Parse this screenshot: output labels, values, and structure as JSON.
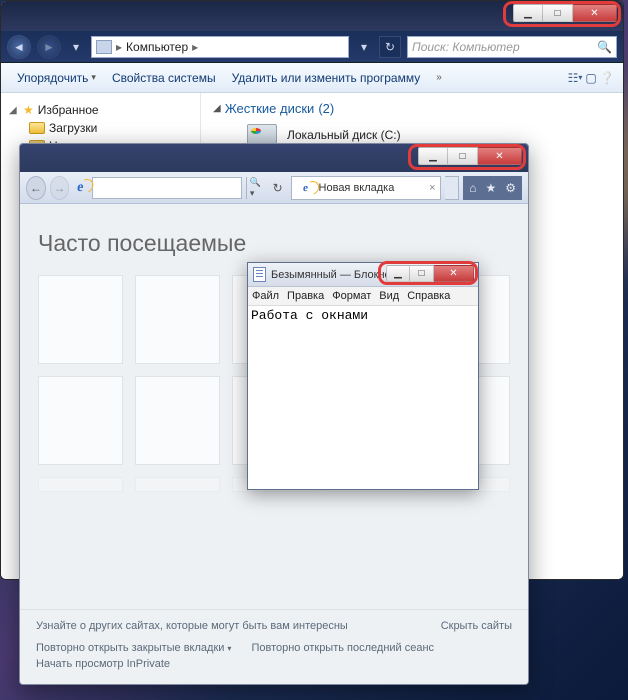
{
  "explorer": {
    "breadcrumb": {
      "root": "Компьютер"
    },
    "search_placeholder": "Поиск: Компьютер",
    "toolbar": {
      "organize": "Упорядочить",
      "system_props": "Свойства системы",
      "uninstall": "Удалить или изменить программу"
    },
    "sidebar": {
      "favorites": "Избранное",
      "downloads": "Загрузки",
      "recent": "Недавние места"
    },
    "content": {
      "hdd_section": "Жесткие диски",
      "hdd_count": "(2)",
      "drive_c": "Локальный диск (C:)"
    }
  },
  "ie": {
    "tab_title": "Новая вкладка",
    "page_heading": "Часто посещаемые",
    "footer": {
      "discover": "Узнайте о других сайтах, которые могут быть вам интересны",
      "hide": "Скрыть сайты",
      "reopen_closed": "Повторно открыть закрытые вкладки",
      "reopen_last": "Повторно открыть последний сеанс",
      "inprivate": "Начать просмотр InPrivate"
    }
  },
  "notepad": {
    "title": "Безымянный — Блокнот",
    "menu": {
      "file": "Файл",
      "edit": "Правка",
      "format": "Формат",
      "view": "Вид",
      "help": "Справка"
    },
    "content": "Работа с окнами"
  }
}
